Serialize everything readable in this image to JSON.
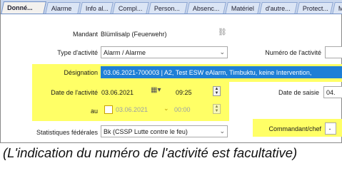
{
  "tabs": [
    "Donné...",
    "Alarme",
    "Info al...",
    "Compl...",
    "Person...",
    "Absenc...",
    "Matériel",
    "d'autre...",
    "Protect...",
    "M"
  ],
  "form": {
    "mandant_label": "Mandant",
    "mandant_value": "Blümlisalp (Feuerwehr)",
    "type_label": "Type d'activité",
    "type_value": "Alarm / Alarme",
    "numero_label": "Numéro de l'activité",
    "designation_label": "Désignation",
    "designation_value": "03.06.2021-700003 | A2, Test ESW eAlarm, Timbuktu, keine Intervention,",
    "date_label": "Date de l'activité",
    "date_value": "03.06.2021",
    "time_value": "09:25",
    "au_label": "au",
    "au_date_value": "03.06.2021",
    "au_time_value": "00:00",
    "saisie_label": "Date de saisie",
    "saisie_value": "04.",
    "stats_label": "Statistiques fédérales",
    "stats_value": "Bk (CSSP Lutte contre le feu)",
    "commandant_label": "Commandant/chef",
    "commandant_value": "-"
  },
  "caption": "(L'indication du numéro de l'activité est facultative)"
}
